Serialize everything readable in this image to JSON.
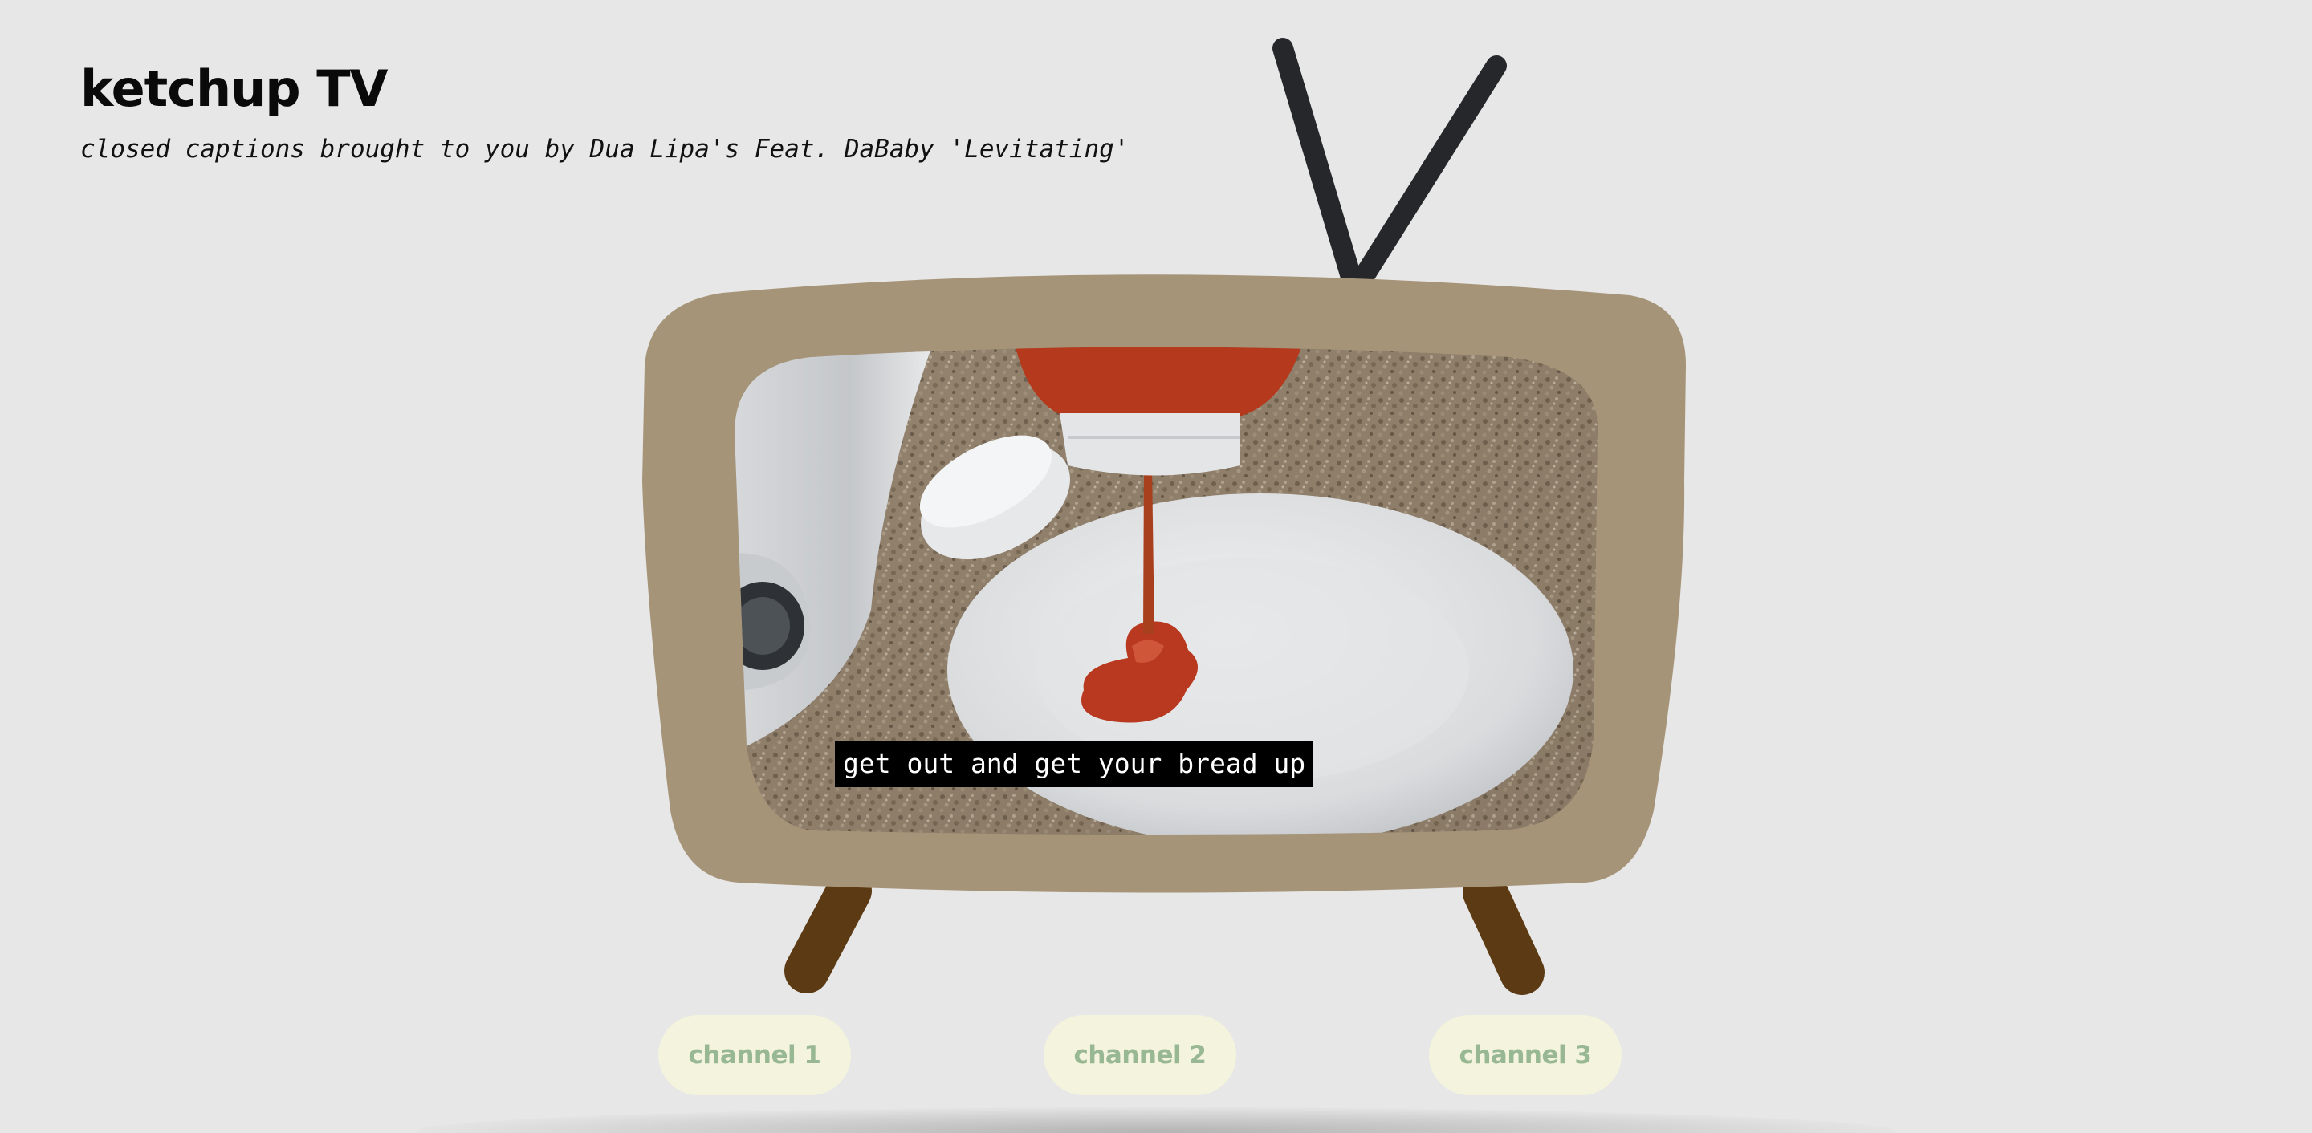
{
  "header": {
    "title": "ketchup TV",
    "subtitle": "closed captions brought to you by Dua Lipa's Feat. DaBaby 'Levitating'"
  },
  "tv": {
    "caption": "get out and get your bread up",
    "colors": {
      "body": "#a69478",
      "antenna": "#25272b",
      "legs": "#5c3b14",
      "caption_bg": "#000000",
      "caption_text": "#ffffff"
    }
  },
  "channels": [
    {
      "label": "channel 1"
    },
    {
      "label": "channel 2"
    },
    {
      "label": "channel 3"
    }
  ],
  "theme": {
    "background": "#e7e7e7",
    "button_bg": "#f4f3dd",
    "button_text": "#98b894"
  }
}
